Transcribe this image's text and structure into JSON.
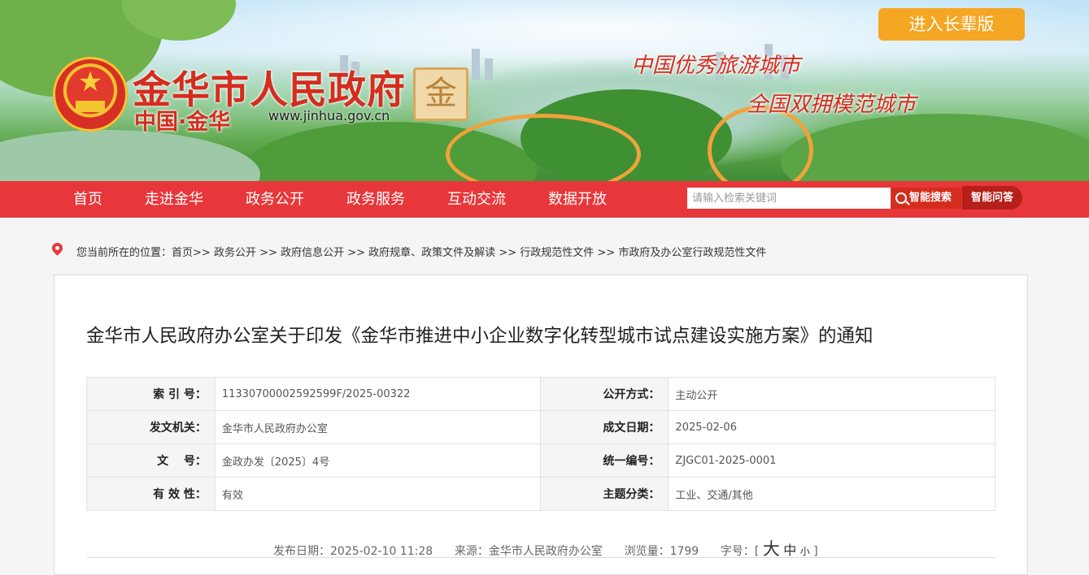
{
  "header": {
    "site_title": "金华市人民政府",
    "site_subtitle": "中国·金华",
    "site_url": "www.jinhua.gov.cn",
    "seal_char": "金",
    "slogan_1": "中国优秀旅游城市",
    "slogan_2": "全国双拥模范城市",
    "elder_mode_label": "进入长辈版"
  },
  "nav": {
    "items": [
      "首页",
      "走进金华",
      "政务公开",
      "政务服务",
      "互动交流",
      "数据开放"
    ],
    "search_placeholder": "请输入检索关键词",
    "search_label": "智能搜索",
    "qa_label": "智能问答"
  },
  "breadcrumb": {
    "prefix": "您当前所在的位置：",
    "items": [
      "首页",
      "政务公开",
      "政府信息公开",
      "政府规章、政策文件及解读",
      "行政规范性文件",
      "市政府及办公室行政规范性文件"
    ],
    "separator": ">>"
  },
  "article": {
    "title": "金华市人民政府办公室关于印发《金华市推进中小企业数字化转型城市试点建设实施方案》的通知",
    "meta": [
      {
        "k1": "索 引 号：",
        "v1": "11330700002592599F/2025-00322",
        "k2": "公开方式：",
        "v2": "主动公开"
      },
      {
        "k1": "发文机关：",
        "v1": "金华市人民政府办公室",
        "k2": "成文日期：",
        "v2": "2025-02-06"
      },
      {
        "k1": "文　 号：",
        "v1": "金政办发〔2025〕4号",
        "k2": "统一编号：",
        "v2": "ZJGC01-2025-0001"
      },
      {
        "k1": "有 效 性：",
        "v1": "有效",
        "k2": "主题分类：",
        "v2": "工业、交通/其他"
      }
    ],
    "publish_date": "发布日期：2025-02-10 11:28",
    "source": "来源：金华市人民政府办公室",
    "views": "浏览量：1799",
    "font_size_label": "字号：",
    "font_big": "大",
    "font_mid": "中",
    "font_small": "小"
  },
  "colors": {
    "nav_red": "#e8373a",
    "title_red": "#d42d1f",
    "elder_orange": "#f5a623"
  }
}
